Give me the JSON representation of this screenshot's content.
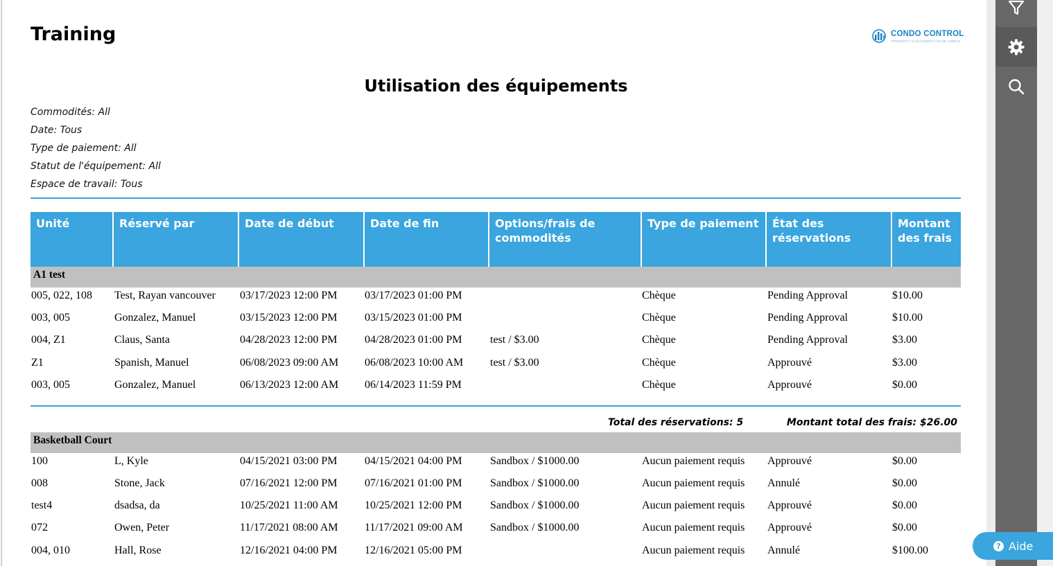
{
  "report": {
    "org_title": "Training",
    "logo_name": "CONDO CONTROL",
    "logo_tagline": "PROPERTY MANAGEMENT MADE SIMPLE",
    "main_title": "Utilisation des équipements",
    "filters": [
      "Commodités: All",
      "Date: Tous",
      "Type de paiement: All",
      "Statut de l'équipement: All",
      "Espace de travail: Tous"
    ]
  },
  "table": {
    "columns": [
      "Unité",
      "Réservé par",
      "Date de début",
      "Date de fin",
      "Options/frais de commodités",
      "Type de paiement",
      "État des réservations",
      "Montant des frais"
    ],
    "groups": [
      {
        "name": "A1 test",
        "rows": [
          [
            "005, 022, 108",
            "Test, Rayan vancouver",
            "03/17/2023 12:00 PM",
            "03/17/2023 01:00 PM",
            "",
            "Chèque",
            "Pending Approval",
            "$10.00"
          ],
          [
            "003, 005",
            "Gonzalez, Manuel",
            "03/15/2023 12:00 PM",
            "03/15/2023 01:00 PM",
            "",
            "Chèque",
            "Pending Approval",
            "$10.00"
          ],
          [
            "004, Z1",
            "Claus, Santa",
            "04/28/2023 12:00 PM",
            "04/28/2023 01:00 PM",
            "test / $3.00",
            "Chèque",
            "Pending Approval",
            "$3.00"
          ],
          [
            "Z1",
            "Spanish, Manuel",
            "06/08/2023 09:00 AM",
            "06/08/2023 10:00 AM",
            "test / $3.00",
            "Chèque",
            "Approuvé",
            "$3.00"
          ],
          [
            "003, 005",
            "Gonzalez, Manuel",
            "06/13/2023 12:00 AM",
            "06/14/2023 11:59 PM",
            "",
            "Chèque",
            "Approuvé",
            "$0.00"
          ]
        ],
        "total_reservations": "Total des réservations: 5",
        "total_fees": "Montant total des frais: $26.00"
      },
      {
        "name": "Basketball Court",
        "rows": [
          [
            "100",
            "L, Kyle",
            "04/15/2021 03:00 PM",
            "04/15/2021 04:00 PM",
            "Sandbox / $1000.00",
            "Aucun paiement requis",
            "Approuvé",
            "$0.00"
          ],
          [
            "008",
            "Stone, Jack",
            "07/16/2021 12:00 PM",
            "07/16/2021 01:00 PM",
            "Sandbox / $1000.00",
            "Aucun paiement requis",
            "Annulé",
            "$0.00"
          ],
          [
            "test4",
            "dsadsa, da",
            "10/25/2021 11:00 AM",
            "10/25/2021 12:00 PM",
            "Sandbox / $1000.00",
            "Aucun paiement requis",
            "Approuvé",
            "$0.00"
          ],
          [
            "072",
            "Owen, Peter",
            "11/17/2021 08:00 AM",
            "11/17/2021 09:00 AM",
            "Sandbox / $1000.00",
            "Aucun paiement requis",
            "Approuvé",
            "$0.00"
          ],
          [
            "004, 010",
            "Hall, Rose",
            "12/16/2021 04:00 PM",
            "12/16/2021 05:00 PM",
            "",
            "Aucun paiement requis",
            "Annulé",
            "$100.00"
          ]
        ]
      }
    ]
  },
  "sidebar": {
    "buttons": [
      {
        "icon": "filter-icon"
      },
      {
        "icon": "gear-icon",
        "active": true
      },
      {
        "icon": "search-icon"
      }
    ]
  },
  "help": {
    "label": "Aide",
    "glyph": "?"
  },
  "colors": {
    "header_blue": "#3aa5de",
    "group_gray": "#c0c0c0",
    "sidebar_gray": "#676767",
    "logo_blue": "#1c83c6"
  }
}
